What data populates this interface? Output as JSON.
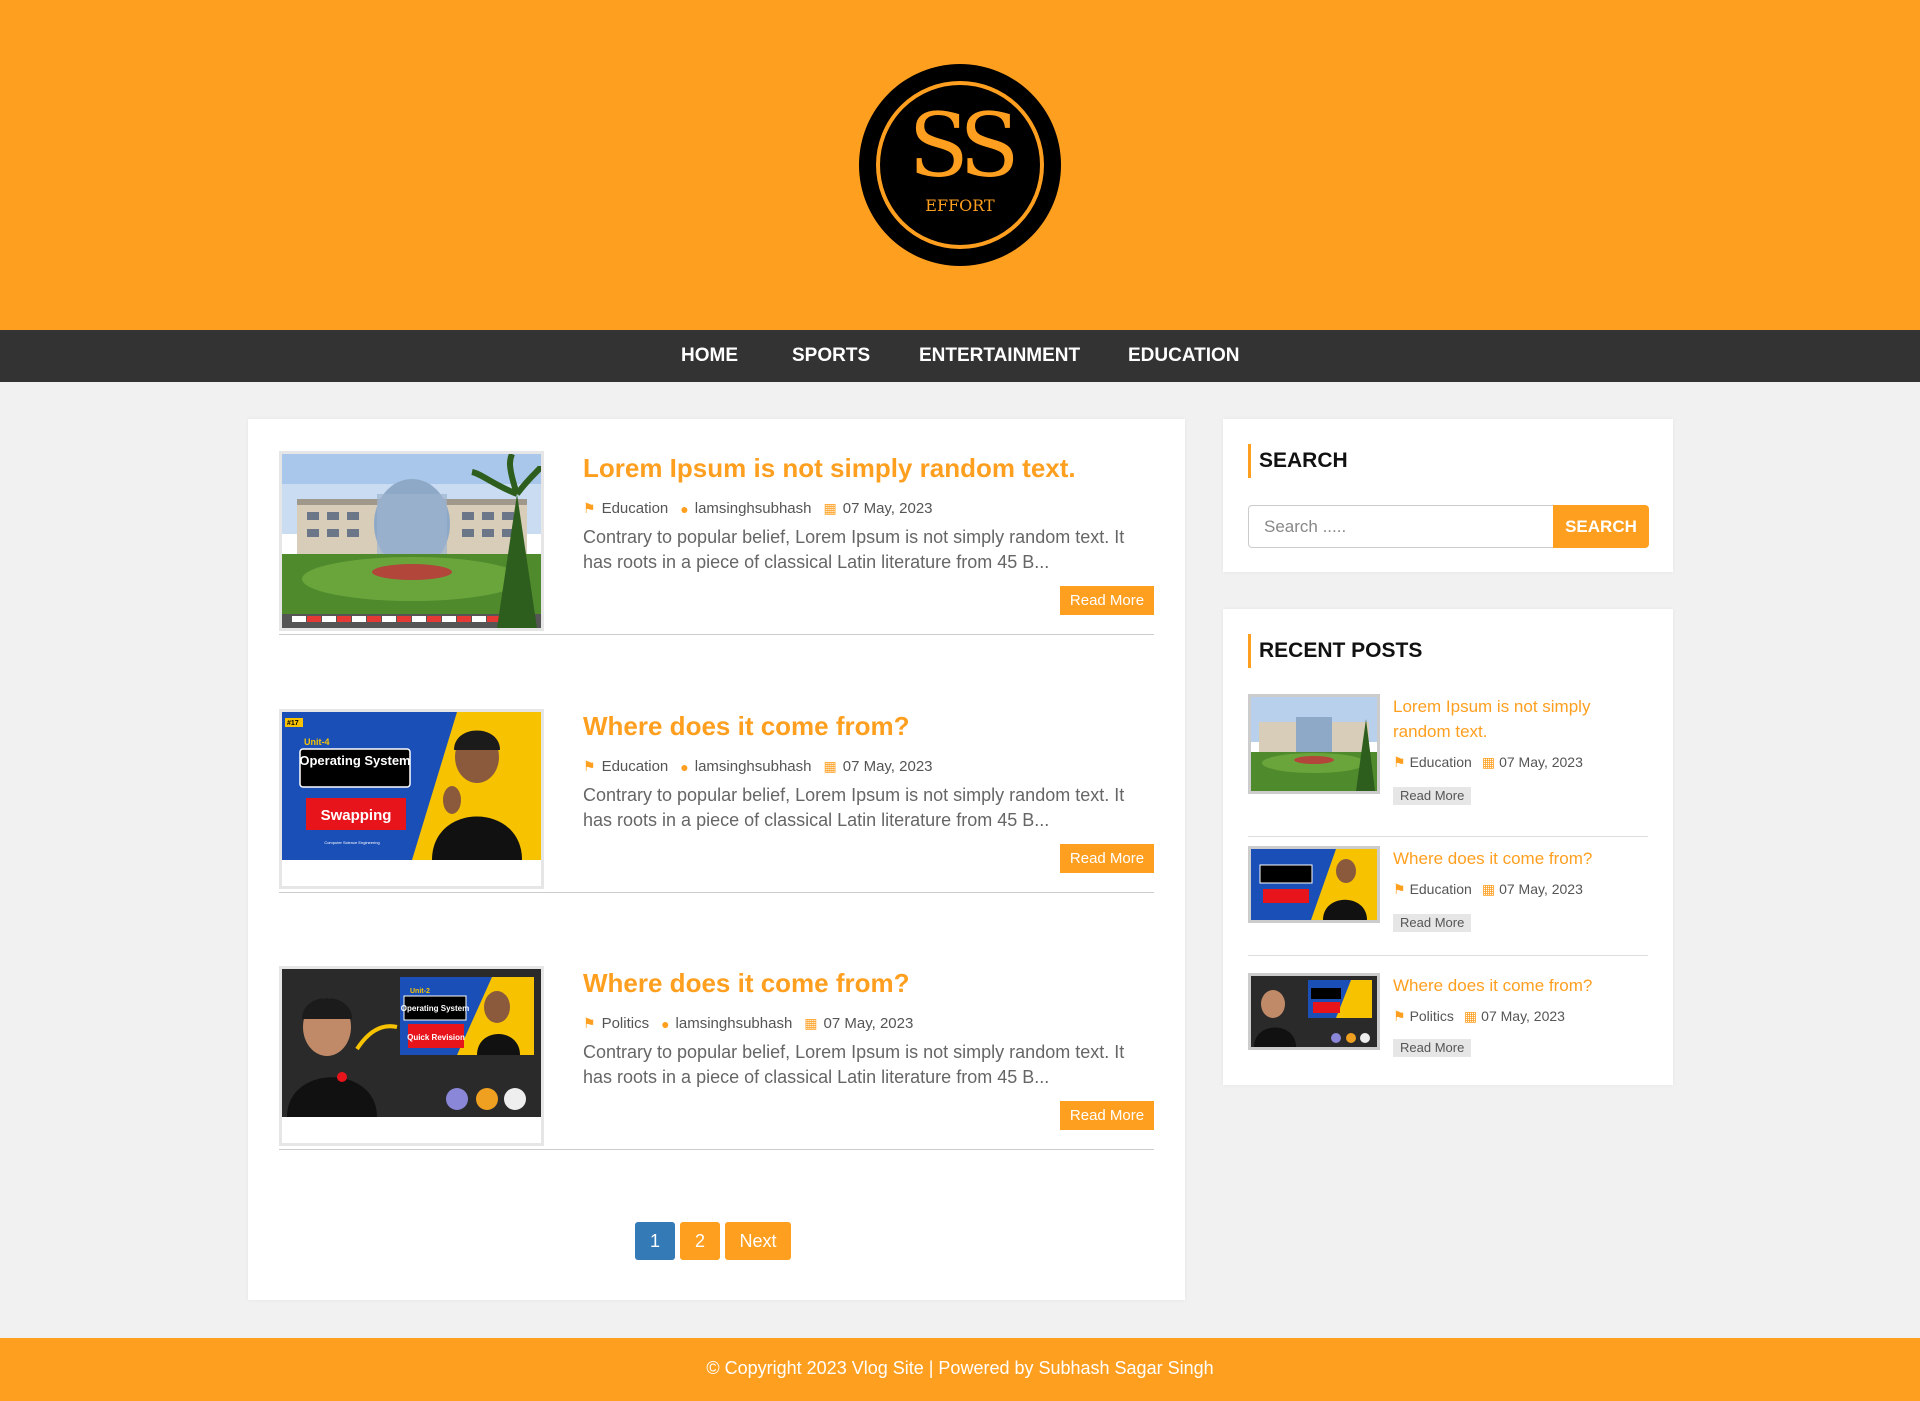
{
  "logo": {
    "initials": "SS",
    "sub": "EFFORT"
  },
  "nav": [
    "HOME",
    "SPORTS",
    "ENTERTAINMENT",
    "EDUCATION"
  ],
  "posts": [
    {
      "title": "Lorem Ipsum is not simply random text.",
      "category": "Education",
      "author": "lamsinghsubhash",
      "date": "07 May, 2023",
      "excerpt": "Contrary to popular belief, Lorem Ipsum is not simply random text. It has roots in a piece of classical Latin literature from 45 B...",
      "read_more": "Read More"
    },
    {
      "title": "Where does it come from?",
      "category": "Education",
      "author": "lamsinghsubhash",
      "date": "07 May, 2023",
      "excerpt": "Contrary to popular belief, Lorem Ipsum is not simply random text. It has roots in a piece of classical Latin literature from 45 B...",
      "read_more": "Read More",
      "thumb_text": {
        "badge": "#17",
        "unit": "Unit-4",
        "subject": "Operating System",
        "topic": "Swapping",
        "caption": "Computer Science Engineering"
      }
    },
    {
      "title": "Where does it come from?",
      "category": "Politics",
      "author": "lamsinghsubhash",
      "date": "07 May, 2023",
      "excerpt": "Contrary to popular belief, Lorem Ipsum is not simply random text. It has roots in a piece of classical Latin literature from 45 B...",
      "read_more": "Read More",
      "thumb_text": {
        "unit": "Unit-2",
        "subject": "Operating System",
        "topic": "Quick Revision"
      }
    }
  ],
  "pagination": {
    "page1": "1",
    "page2": "2",
    "next": "Next",
    "active_color": "#337ab7",
    "color": "#ff9f1f"
  },
  "sidebar": {
    "search": {
      "title": "SEARCH",
      "placeholder": "Search .....",
      "button": "SEARCH"
    },
    "recent": {
      "title": "RECENT POSTS",
      "items": [
        {
          "title": "Lorem Ipsum is not simply random text.",
          "category": "Education",
          "date": "07 May, 2023",
          "button": "Read More"
        },
        {
          "title": "Where does it come from?",
          "category": "Education",
          "date": "07 May, 2023",
          "button": "Read More"
        },
        {
          "title": "Where does it come from?",
          "category": "Politics",
          "date": "07 May, 2023",
          "button": "Read More"
        }
      ]
    }
  },
  "footer": "© Copyright 2023 Vlog Site | Powered by Subhash Sagar Singh",
  "colors": {
    "accent": "#ff9f1f",
    "nav_bg": "#333333",
    "page_bg": "#f1f1f1"
  },
  "icons": {
    "category": "tag-icon",
    "author": "user-icon",
    "date": "calendar-icon"
  }
}
